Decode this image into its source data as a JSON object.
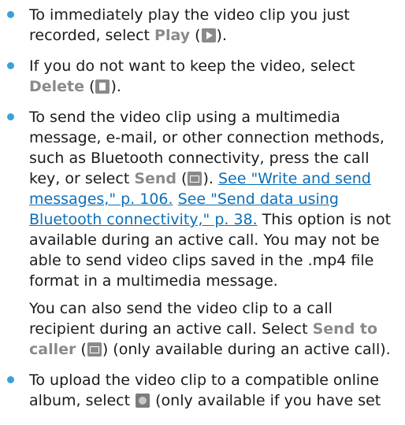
{
  "items": [
    {
      "t1": "To immediately play the video clip you just recorded, select ",
      "opt": "Play",
      "t2": " (",
      "t3": ")."
    },
    {
      "t1": "If you do not want to keep the video, select ",
      "opt": "Delete",
      "t2": " (",
      "t3": ")."
    },
    {
      "t1": "To send the video clip using a multimedia message, e-mail, or other connection methods, such as Bluetooth connectivity, press the call key, or select ",
      "opt": "Send",
      "t2": " (",
      "t3": "). ",
      "link1": "See \"Write and send messages,\" p. 106.",
      "link2": "See \"Send data using Bluetooth connectivity,\" p. 38.",
      "t4": " This option is not available during an active call. You may not be able to send video clips saved in the .mp4 file format in a multimedia message."
    },
    {
      "t1": "You can also send the video clip to a call recipient during an active call. Select ",
      "opt": "Send to caller",
      "t2": " (",
      "t3": ") (only available during an active call)."
    },
    {
      "t1": "To upload the video clip to a compatible online album, select ",
      "t2": " (only available if you have set"
    }
  ],
  "icons": [
    "play-icon",
    "delete-icon",
    "send-icon",
    "send-to-caller-icon",
    "online-album-icon"
  ]
}
